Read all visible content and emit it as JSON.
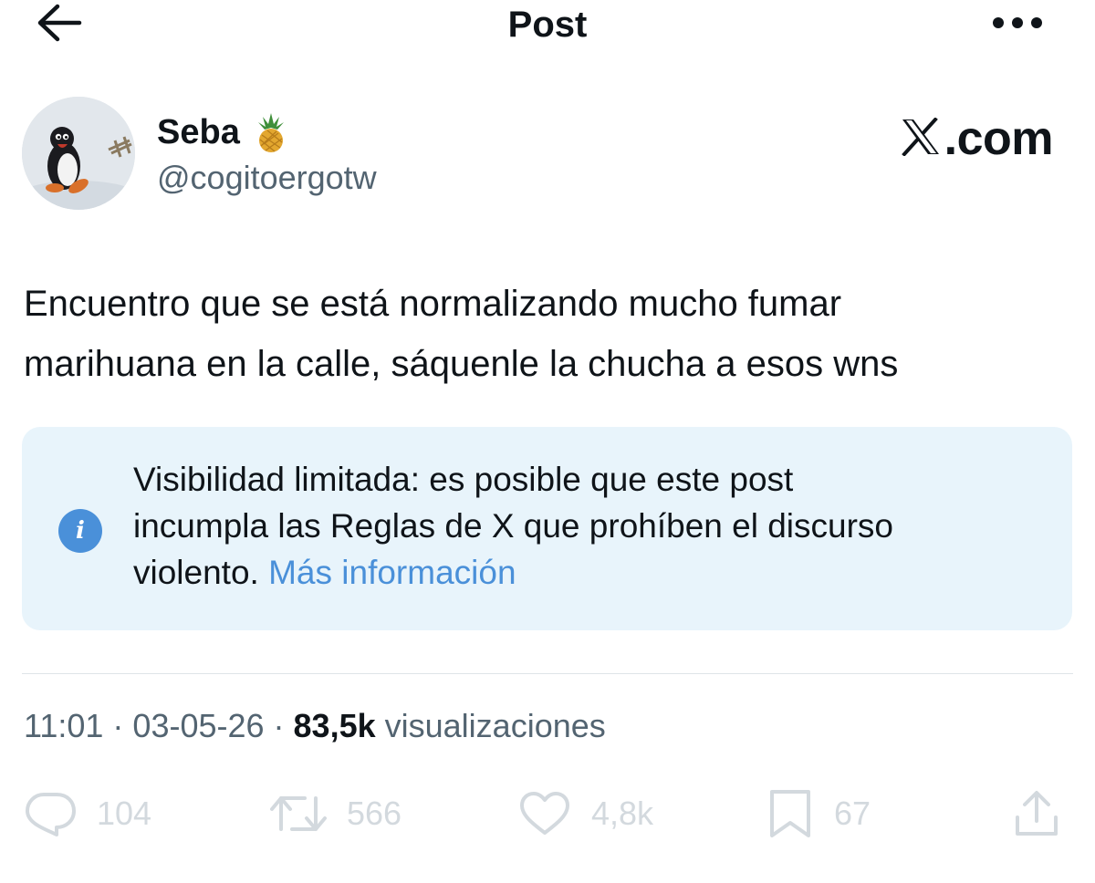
{
  "header": {
    "title": "Post",
    "back_icon": "arrow-left-icon",
    "more_icon": "ellipsis-icon"
  },
  "author": {
    "display_name": "Seba",
    "badge_emoji": "pineapple-icon",
    "handle": "@cogitoergotw"
  },
  "watermark": {
    "logo_icon": "x-logo-icon",
    "text": ".com"
  },
  "post": {
    "text_line1": "Encuentro que se está normalizando mucho fumar",
    "text_line2": "marihuana en la calle, sáquenle la chucha a esos wns"
  },
  "notice": {
    "icon": "info-icon",
    "text_line1": "Visibilidad limitada: es posible que este post",
    "text_line2": "incumpla las Reglas de X que prohíben el discurso",
    "text_line3": "violento.",
    "link_label": "Más información",
    "link_color": "#4a90d9",
    "background": "#e8f4fb"
  },
  "meta": {
    "time": "11:01",
    "sep1": " · ",
    "date": "03-05-26",
    "sep2": " · ",
    "views_count": "83,5k",
    "views_label": "visualizaciones"
  },
  "actions": {
    "reply": {
      "icon": "reply-icon",
      "count": "104"
    },
    "repost": {
      "icon": "repost-icon",
      "count": "566"
    },
    "like": {
      "icon": "heart-icon",
      "count": "4,8k"
    },
    "bookmark": {
      "icon": "bookmark-icon",
      "count": "67"
    },
    "share": {
      "icon": "share-icon"
    }
  }
}
